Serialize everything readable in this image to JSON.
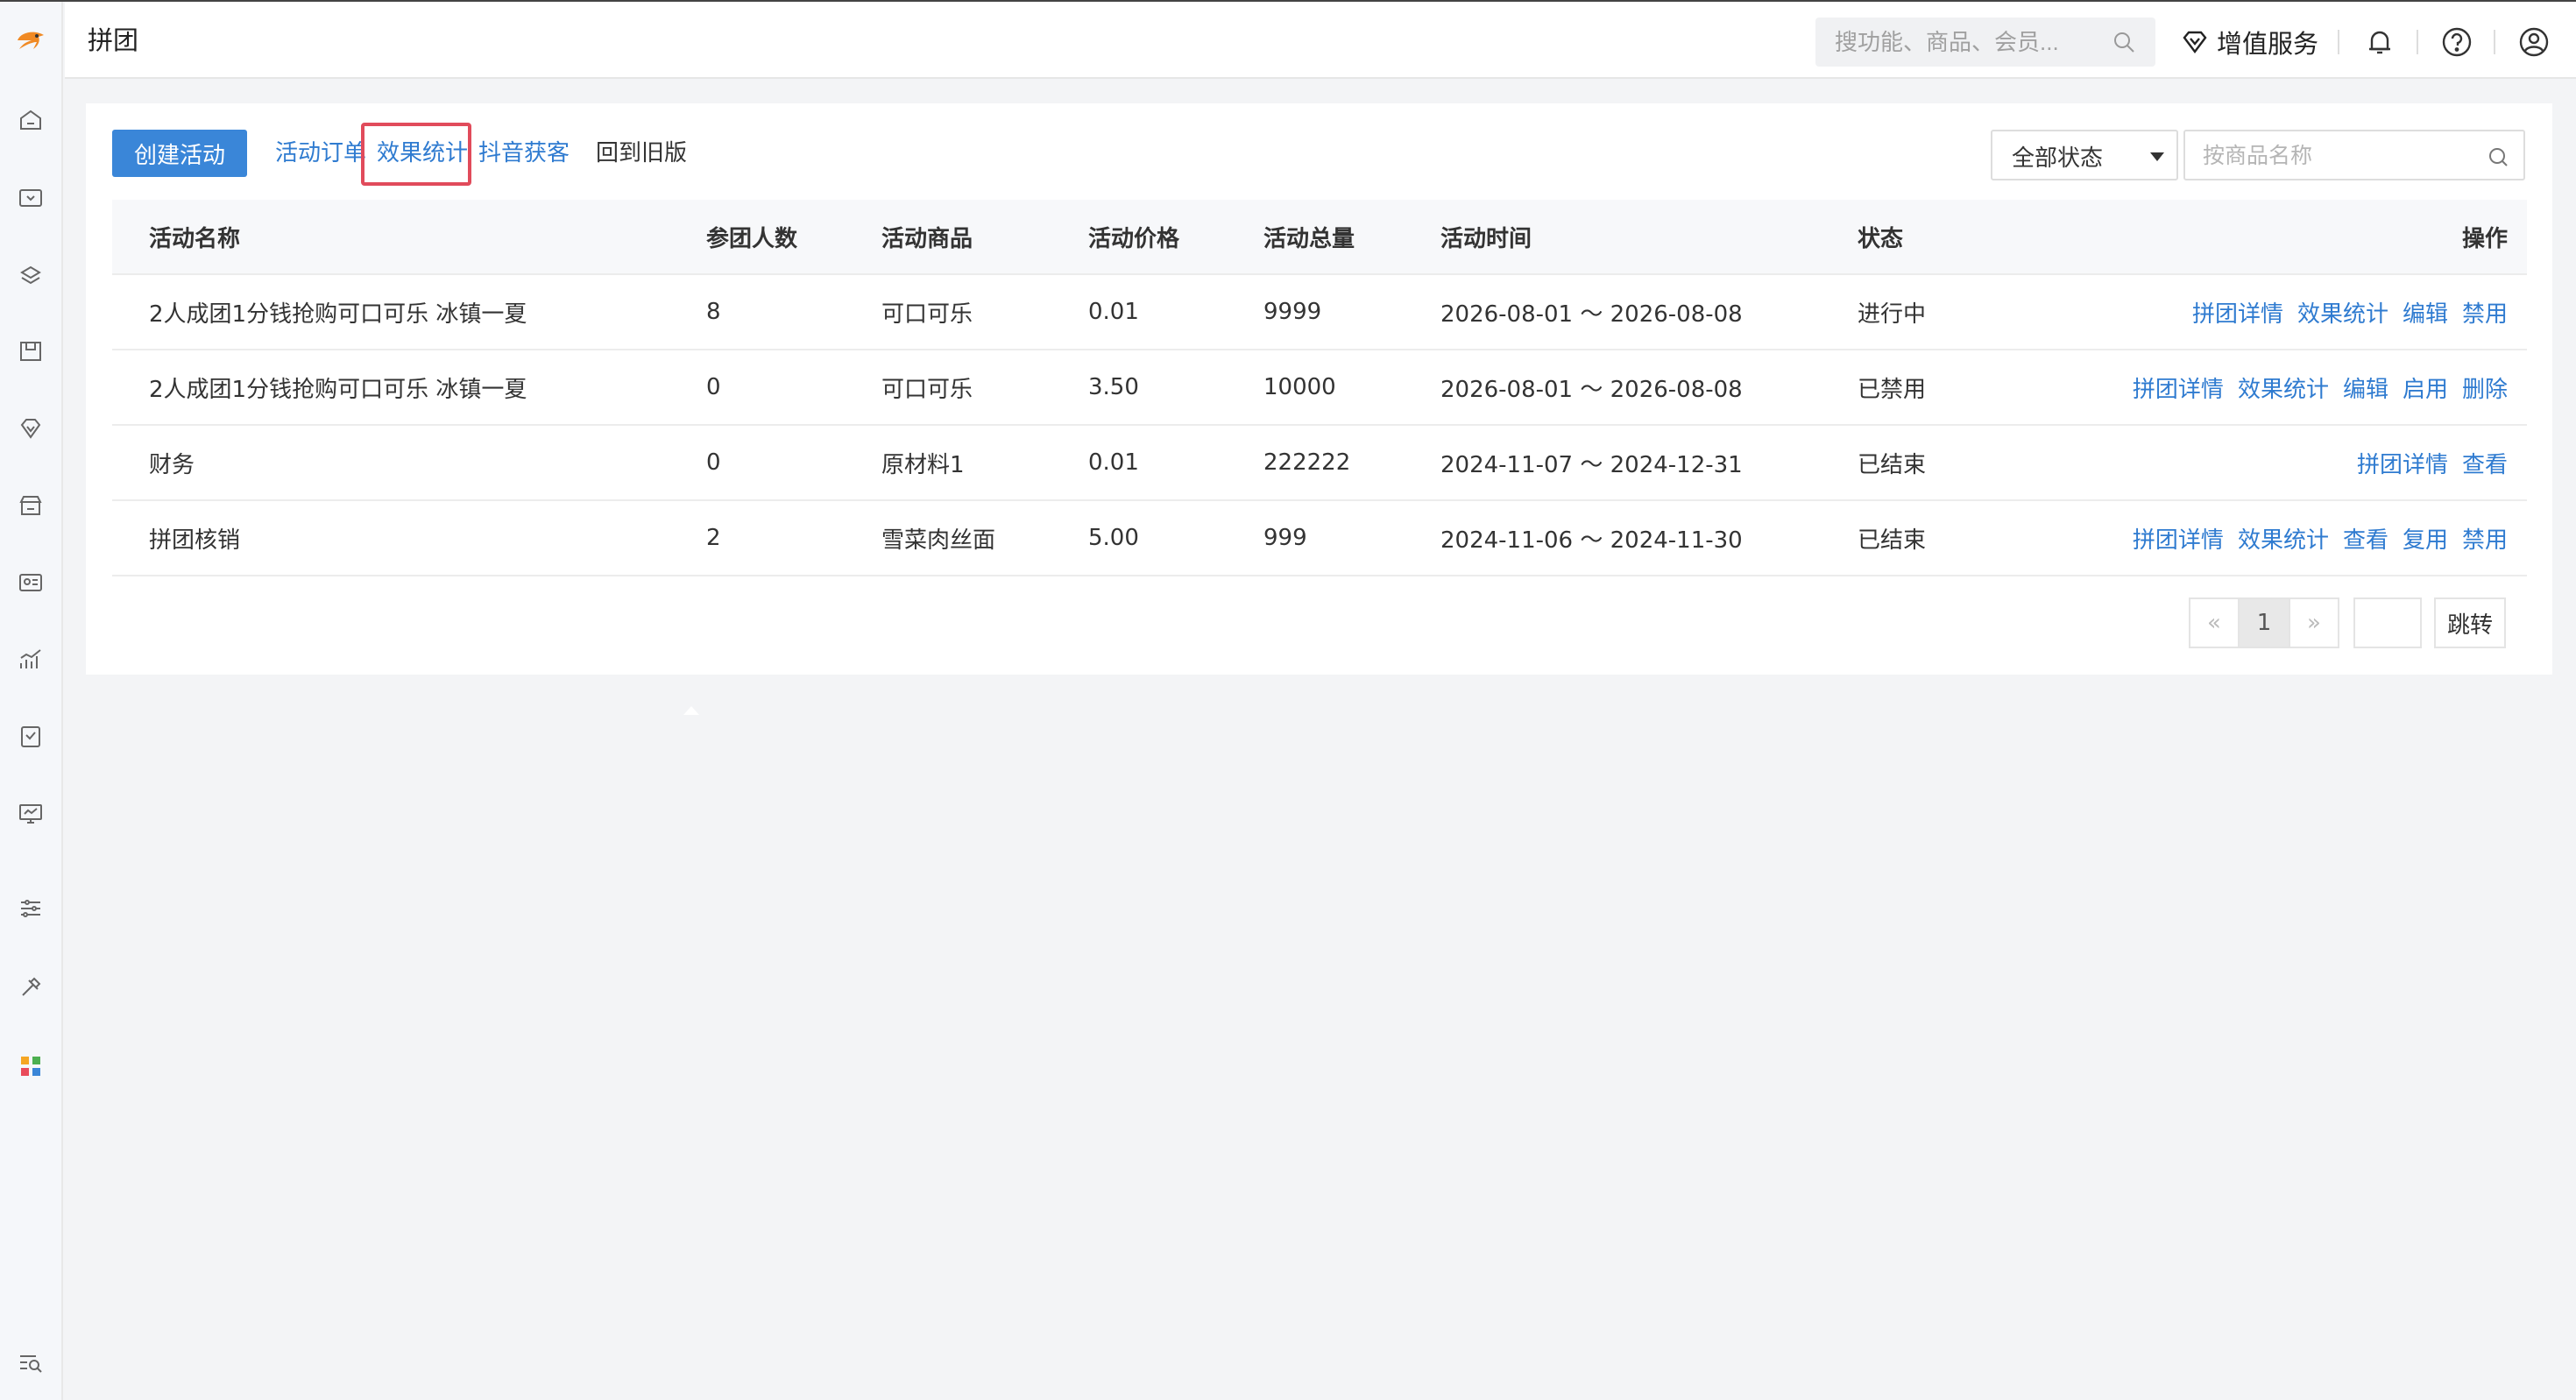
{
  "header": {
    "title": "拼团",
    "search_placeholder": "搜功能、商品、会员...",
    "vip_label": "增值服务"
  },
  "toolbar": {
    "create_label": "创建活动",
    "links": [
      "活动订单",
      "效果统计",
      "抖音获客",
      "回到旧版"
    ],
    "status_select": "全部状态",
    "goods_search_placeholder": "按商品名称"
  },
  "table": {
    "headers": {
      "name": "活动名称",
      "count": "参团人数",
      "goods": "活动商品",
      "price": "活动价格",
      "total": "活动总量",
      "time": "活动时间",
      "status": "状态",
      "ops": "操作"
    },
    "rows": [
      {
        "name": "2人成团1分钱抢购可口可乐 冰镇一夏",
        "count": "8",
        "goods": "可口可乐",
        "price": "0.01",
        "total": "9999",
        "time": "2026-08-01 ～ 2026-08-08",
        "status": "进行中",
        "ops": [
          "拼团详情",
          "效果统计",
          "编辑",
          "禁用"
        ]
      },
      {
        "name": "2人成团1分钱抢购可口可乐 冰镇一夏",
        "count": "0",
        "goods": "可口可乐",
        "price": "3.50",
        "total": "10000",
        "time": "2026-08-01 ～ 2026-08-08",
        "status": "已禁用",
        "ops": [
          "拼团详情",
          "效果统计",
          "编辑",
          "启用",
          "删除"
        ]
      },
      {
        "name": "财务",
        "count": "0",
        "goods": "原材料1",
        "price": "0.01",
        "total": "222222",
        "time": "2024-11-07 ～ 2024-12-31",
        "status": "已结束",
        "ops": [
          "拼团详情",
          "查看"
        ]
      },
      {
        "name": "拼团核销",
        "count": "2",
        "goods": "雪菜肉丝面",
        "price": "5.00",
        "total": "999",
        "time": "2024-11-06 ～ 2024-11-30",
        "status": "已结束",
        "ops": [
          "拼团详情",
          "效果统计",
          "查看",
          "复用",
          "禁用"
        ]
      }
    ]
  },
  "pagination": {
    "prev": "«",
    "current": "1",
    "next": "»",
    "jump_label": "跳转"
  },
  "colors": {
    "accent": "#3a86d8",
    "link": "#2f7bd0",
    "highlight": "#e14b5b"
  }
}
